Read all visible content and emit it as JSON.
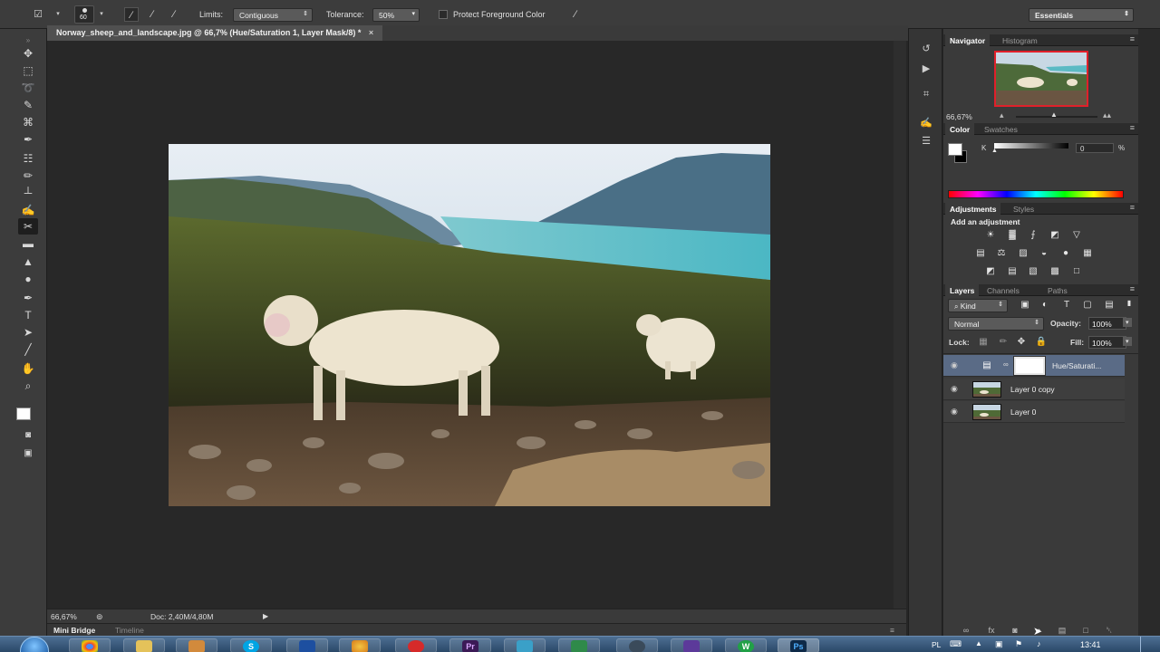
{
  "options_bar": {
    "brush_size": "60",
    "limits_label": "Limits:",
    "limits_value": "Contiguous",
    "tolerance_label": "Tolerance:",
    "tolerance_value": "50%",
    "protect_label": "Protect Foreground Color",
    "workspace": "Essentials"
  },
  "document": {
    "tab_title": "Norway_sheep_and_landscape.jpg @ 66,7% (Hue/Saturation 1, Layer Mask/8) *",
    "zoom": "66,67%",
    "doc_info": "Doc: 2,40M/4,80M"
  },
  "bottom_tabs": [
    "Mini Bridge",
    "Timeline"
  ],
  "navigator": {
    "tabs": [
      "Navigator",
      "Histogram"
    ],
    "zoom": "66,67%"
  },
  "color_panel": {
    "tabs": [
      "Color",
      "Swatches"
    ],
    "channel_label": "K",
    "channel_value": "0",
    "unit": "%"
  },
  "adjustments": {
    "tabs": [
      "Adjustments",
      "Styles"
    ],
    "heading": "Add an adjustment"
  },
  "layers_panel": {
    "tabs": [
      "Layers",
      "Channels",
      "Paths"
    ],
    "filter_kind": "Kind",
    "blend_mode": "Normal",
    "opacity_label": "Opacity:",
    "opacity_value": "100%",
    "lock_label": "Lock:",
    "fill_label": "Fill:",
    "fill_value": "100%",
    "layers": [
      {
        "name": "Hue/Saturati..."
      },
      {
        "name": "Layer 0 copy"
      },
      {
        "name": "Layer 0"
      }
    ]
  },
  "taskbar": {
    "language": "PL",
    "time": "13:41",
    "apps": [
      "start",
      "chrome",
      "explorer",
      "media",
      "skype",
      "dictionary",
      "browser",
      "opera",
      "premiere",
      "app",
      "excel",
      "steam",
      "vs",
      "wordpress",
      "photoshop"
    ]
  },
  "colors": {
    "accent_selection": "#5a6b86",
    "navigator_frame": "#e0202a"
  }
}
